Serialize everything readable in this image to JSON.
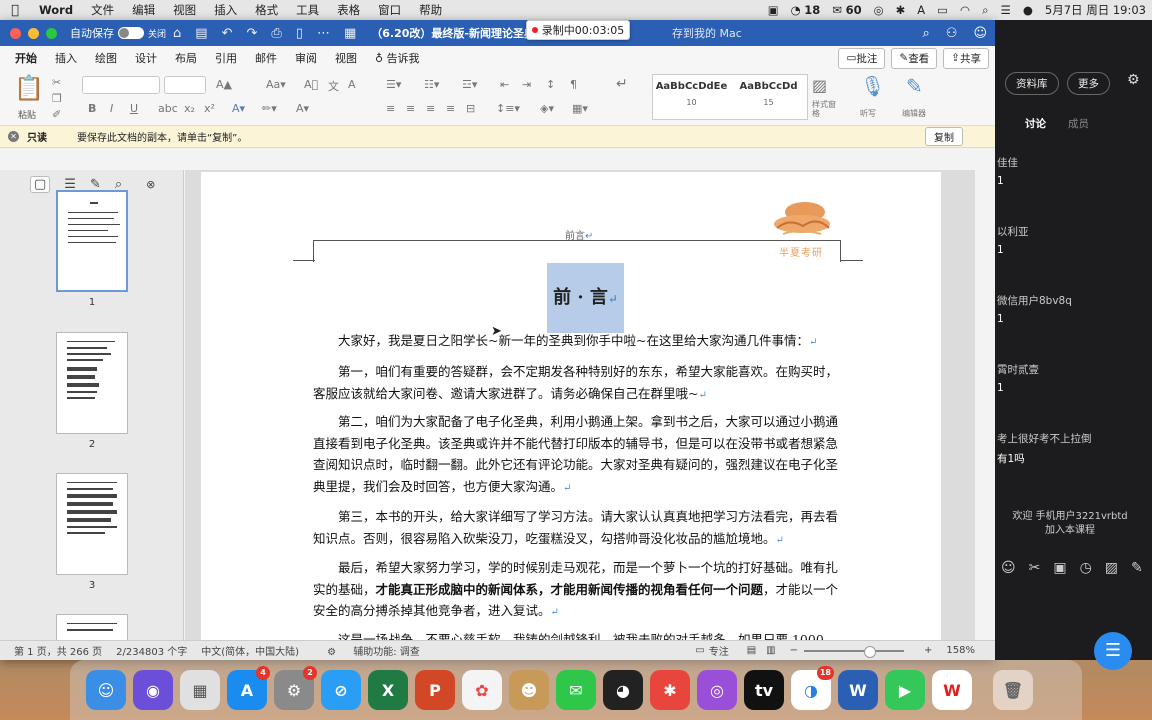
{
  "menubar": {
    "app_name": "Word",
    "items": [
      "文件",
      "编辑",
      "视图",
      "插入",
      "格式",
      "工具",
      "表格",
      "窗口",
      "帮助"
    ],
    "status": {
      "cpu": "18",
      "wechat": "60"
    },
    "datetime": "5月7日 周日  19:03"
  },
  "recording": {
    "label": "录制中00:03:05"
  },
  "window": {
    "autosave_label": "自动保存",
    "autosave_state": "关闭",
    "doc_title": "（6.20改）最终版-新闻理论圣典完成稿",
    "save_location": "存到我的 Mac"
  },
  "ribbon_tabs": [
    "开始",
    "插入",
    "绘图",
    "设计",
    "布局",
    "引用",
    "邮件",
    "审阅",
    "视图"
  ],
  "ribbon_tellme": "告诉我",
  "ribbon_actions": {
    "comment": "批注",
    "view": "查看",
    "share": "共享"
  },
  "ribbon": {
    "paste_label": "粘贴",
    "styles": [
      {
        "sample": "AaBbCcDdEe",
        "name": "10"
      },
      {
        "sample": "AaBbCcDd",
        "name": "15"
      }
    ],
    "styles_pane": "样式窗格",
    "dictate": "听写",
    "editor": "编辑器"
  },
  "infobar": {
    "label": "只读",
    "message": "要保存此文档的副本，请单击“复制”。",
    "copy_button": "复制"
  },
  "thumbnails": [
    {
      "num": "1"
    },
    {
      "num": "2"
    },
    {
      "num": "3"
    }
  ],
  "document": {
    "header_text": "前言",
    "brand": "半夏考研",
    "heading": "前 · 言",
    "paragraphs": [
      "大家好，我是夏日之阳学长~新一年的圣典到你手中啦~在这里给大家沟通几件事情：",
      "第一，咱们有重要的答疑群，会不定期发各种特别好的东东，希望大家能喜欢。在购买时，客服应该就给大家问卷、邀请大家进群了。请务必确保自己在群里哦~",
      "第二，咱们为大家配备了电子化圣典，利用小鹅通上架。拿到书之后，大家可以通过小鹅通直接看到电子化圣典。该圣典或许并不能代替打印版本的辅导书，但是可以在没带书或者想紧急查阅知识点时，临时翻一翻。此外它还有评论功能。大家对圣典有疑问的，强烈建议在电子化圣典里提，我们会及时回答，也方便大家沟通。",
      "第三，本书的开头，给大家详细写了学习方法。请大家认认真真地把学习方法看完，再去看知识点。否则，很容易陷入砍柴没刀，吃蛋糕没叉，勾搭帅哥没化妆品的尴尬境地。",
      "最后，希望大家努力学习，学的时候别走马观花，而是一个萝卜一个坑的打好基础。唯有扎实的基础，",
      "，才能以一个安全的高分搏杀掉其他竞争者，进入复试。",
      "这是一场战争，不要心慈手软，我铸的剑越锋利，被我击败的对手越多。如果只要 1000"
    ],
    "bold_segment": "才能真正形成脑中的新闻体系，才能用新闻传播的视角看任何一个问题"
  },
  "statusbar": {
    "page": "第 1 页，共 266 页",
    "words": "2/234803 个字",
    "lang": "中文(简体，中国大陆)",
    "accessibility": "辅助功能: 调查",
    "focus": "专注",
    "zoom": "158%"
  },
  "chat": {
    "buttons": [
      "资料库",
      "更多"
    ],
    "tabs": [
      "讨论",
      "成员"
    ],
    "messages": [
      {
        "name": "佳佳",
        "text": "1"
      },
      {
        "name": "以利亚",
        "text": "1"
      },
      {
        "name": "微信用户8bv8q",
        "text": "1"
      },
      {
        "name": "霄时贰壹",
        "text": "1"
      },
      {
        "name": "考上很好考不上拉倒",
        "text": "有1吗"
      }
    ],
    "welcome": "欢迎 手机用户3221vrbtd",
    "welcome2": "加入本课程"
  },
  "dock": {
    "badges": {
      "appstore": "4",
      "settings": "2",
      "browser": "18"
    }
  }
}
